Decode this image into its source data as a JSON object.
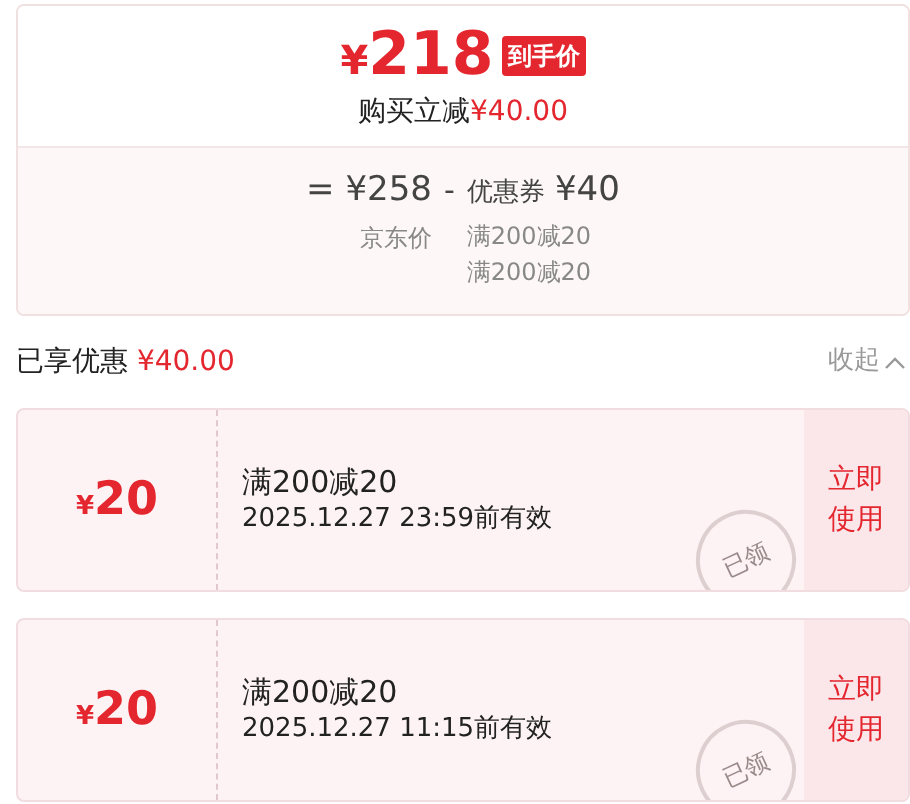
{
  "summary": {
    "currency": "¥",
    "price": "218",
    "badge": "到手价",
    "instant_discount_label": "购买立减",
    "instant_discount_amount": "¥40.00",
    "formula": {
      "equals": "=",
      "base_price": "¥258",
      "minus": "-",
      "coupon_label": "优惠券",
      "coupon_amount": "¥40",
      "base_label": "京东价",
      "coupon_rules": [
        "满200减20",
        "满200减20"
      ]
    }
  },
  "discount_header": {
    "label": "已享优惠",
    "amount": "¥40.00",
    "toggle": "收起"
  },
  "coupons": [
    {
      "currency": "¥",
      "amount": "20",
      "title": "满200减20",
      "validity": "2025.12.27 23:59前有效",
      "stamp": "已领",
      "action": [
        "立即",
        "使用"
      ]
    },
    {
      "currency": "¥",
      "amount": "20",
      "title": "满200减20",
      "validity": "2025.12.27 11:15前有效",
      "stamp": "已领",
      "action": [
        "立即",
        "使用"
      ]
    }
  ]
}
